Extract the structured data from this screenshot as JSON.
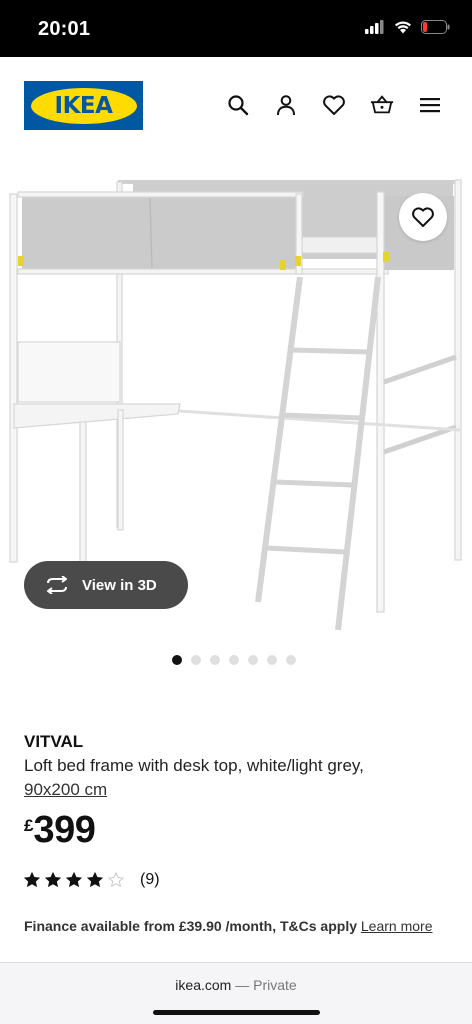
{
  "status_bar": {
    "time": "20:01"
  },
  "header": {
    "logo_text": "IKEA",
    "brand_colors": {
      "blue": "#0058a3",
      "yellow": "#ffdb00"
    },
    "icons": [
      "search-icon",
      "account-icon",
      "heart-icon",
      "basket-icon",
      "menu-icon"
    ]
  },
  "hero": {
    "view_3d_label": "View in 3D",
    "carousel": {
      "total": 7,
      "active_index": 0
    }
  },
  "product": {
    "name": "VITVAL",
    "description": "Loft bed frame with desk top, white/light grey,",
    "size": "90x200 cm",
    "price_currency": "£",
    "price_value": "399",
    "rating": {
      "stars": 4,
      "max": 5,
      "count_label": "(9)"
    },
    "finance_text": "Finance available from £39.90 /month, T&Cs apply",
    "finance_link": "Learn more"
  },
  "browser": {
    "domain": "ikea.com",
    "separator": "—",
    "mode": "Private"
  }
}
